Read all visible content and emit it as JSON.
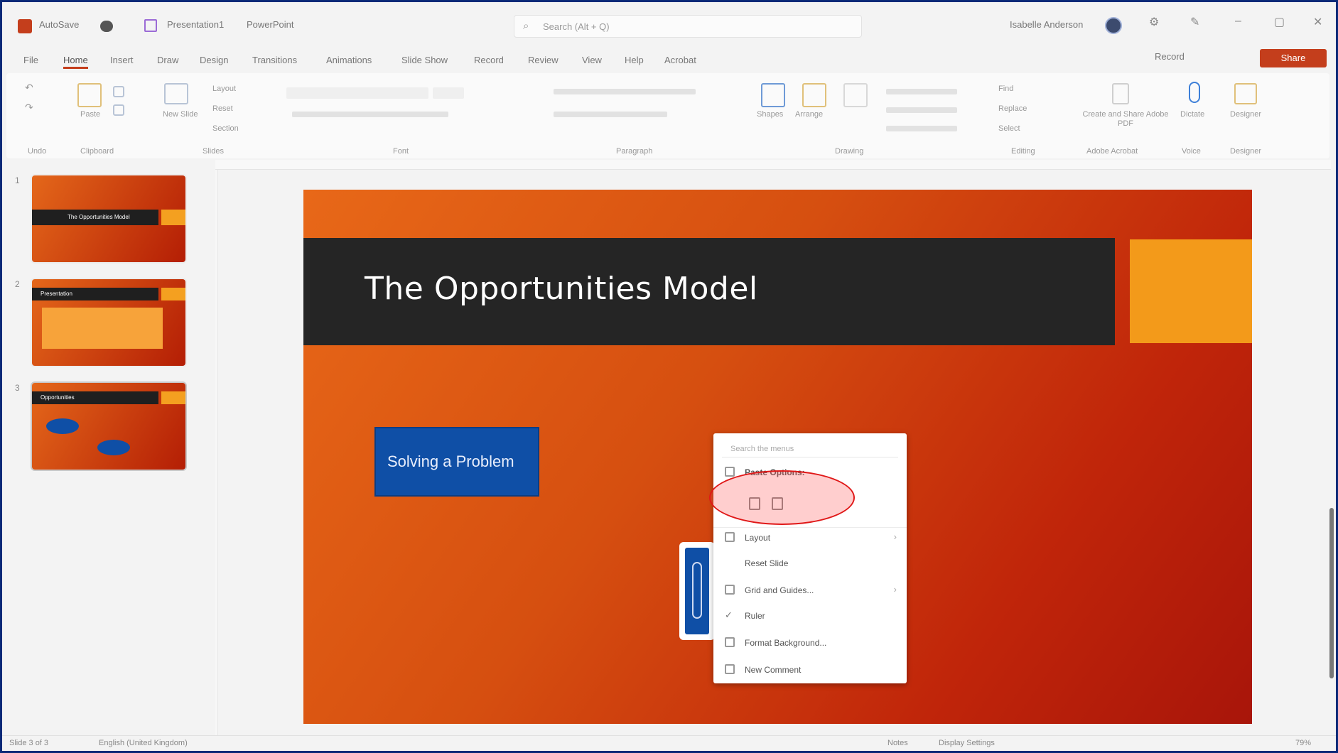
{
  "titlebar": {
    "autosave_label": "AutoSave",
    "doc_name": "Presentation1",
    "app_name": "PowerPoint",
    "search_placeholder": "Search (Alt + Q)",
    "user_name": "Isabelle Anderson"
  },
  "tabs": [
    {
      "label": "File"
    },
    {
      "label": "Home"
    },
    {
      "label": "Insert"
    },
    {
      "label": "Draw"
    },
    {
      "label": "Design"
    },
    {
      "label": "Transitions"
    },
    {
      "label": "Animations"
    },
    {
      "label": "Slide Show"
    },
    {
      "label": "Record"
    },
    {
      "label": "Review"
    },
    {
      "label": "View"
    },
    {
      "label": "Help"
    },
    {
      "label": "Acrobat"
    }
  ],
  "tab_right": {
    "record_label": "Record",
    "share_label": "Share"
  },
  "ribbon": {
    "groups": [
      {
        "label": "Undo"
      },
      {
        "label": "Clipboard"
      },
      {
        "label": "Slides"
      },
      {
        "label": "Font"
      },
      {
        "label": "Paragraph"
      },
      {
        "label": "Drawing"
      },
      {
        "label": "Editing"
      },
      {
        "label": "Adobe Acrobat"
      },
      {
        "label": "Voice"
      },
      {
        "label": "Designer"
      }
    ],
    "buttons": {
      "paste": "Paste",
      "new_slide": "New Slide",
      "layout": "Layout",
      "reset": "Reset",
      "section": "Section",
      "shapes": "Shapes",
      "arrange": "Arrange",
      "find": "Find",
      "replace": "Replace",
      "select": "Select",
      "create_pdf": "Create and Share Adobe PDF",
      "dictate": "Dictate",
      "designer": "Designer"
    }
  },
  "thumbnails": [
    {
      "num": "1",
      "title": "The Opportunities Model"
    },
    {
      "num": "2",
      "title": "Presentation"
    },
    {
      "num": "3",
      "title": "Opportunities"
    }
  ],
  "slide": {
    "title": "The Opportunities Model",
    "box_text": "Solving a Problem"
  },
  "context_menu": {
    "search_placeholder": "Search the menus",
    "items": [
      {
        "label": "Paste Options:"
      },
      {
        "label": "Layout"
      },
      {
        "label": "Reset Slide"
      },
      {
        "label": "Grid and Guides..."
      },
      {
        "label": "Ruler"
      },
      {
        "label": "Format Background..."
      },
      {
        "label": "New Comment"
      }
    ]
  },
  "status": {
    "slide_indicator": "Slide 3 of 3",
    "accessibility": "English (United Kingdom)",
    "notes": "Notes",
    "display_settings": "Display Settings",
    "zoom": "79%"
  },
  "colors": {
    "accent": "#c43e1c",
    "slide_blue": "#0f4fa6",
    "slide_orange": "#e86818",
    "slide_band": "#252525",
    "highlight": "#e01818"
  }
}
